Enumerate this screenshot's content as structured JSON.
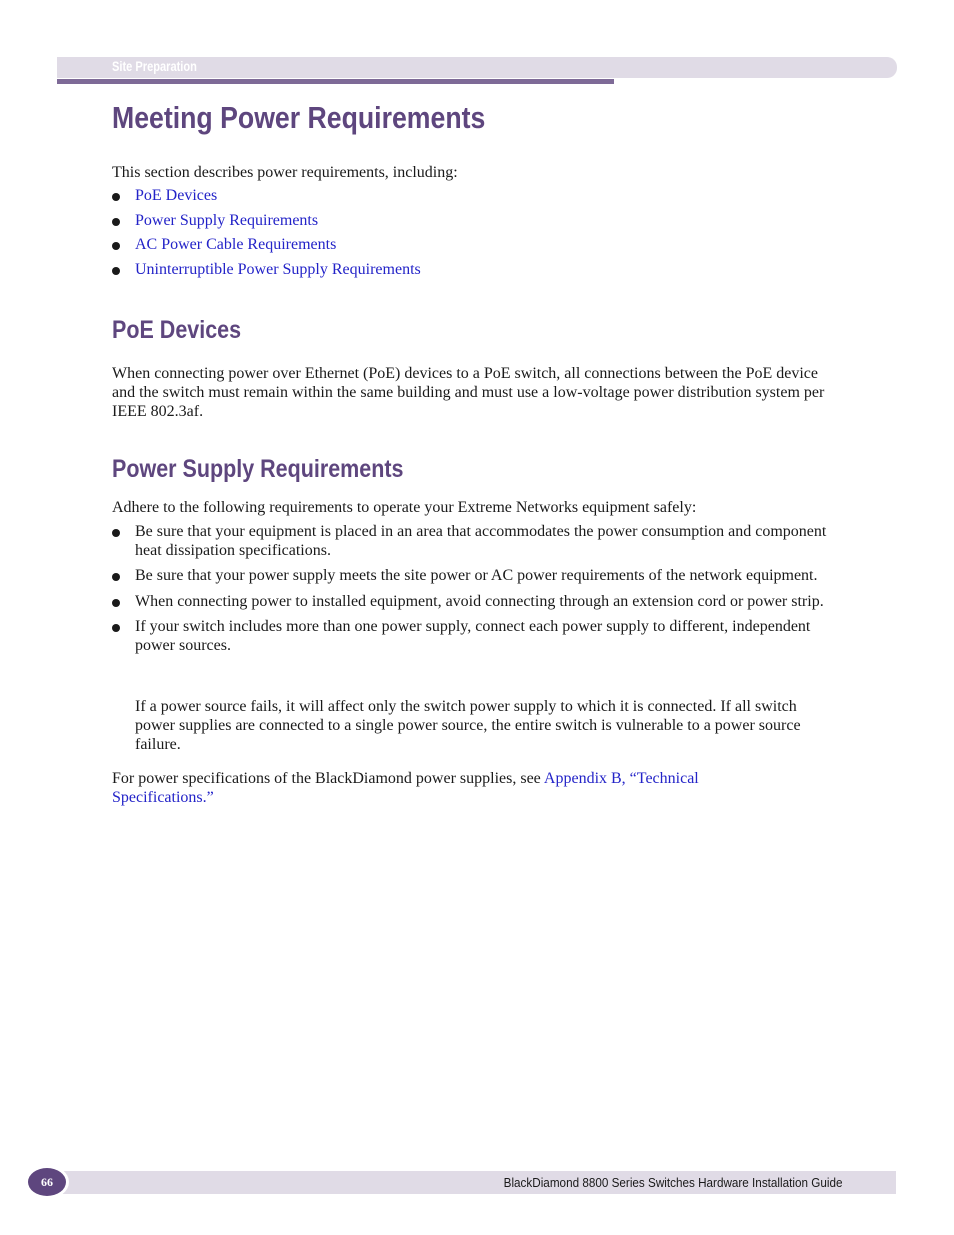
{
  "header": {
    "section_label": "Site Preparation"
  },
  "page_title": "Meeting Power Requirements",
  "intro": {
    "text": "This section describes power requirements, including:",
    "links": [
      {
        "label": "PoE Devices"
      },
      {
        "label": "Power Supply Requirements"
      },
      {
        "label": "AC Power Cable Requirements"
      },
      {
        "label": "Uninterruptible Power Supply Requirements"
      }
    ]
  },
  "poe_section": {
    "heading": "PoE Devices",
    "body": "When connecting power over Ethernet (PoE) devices to a PoE switch, all connections between the PoE device and the switch must remain within the same building and must use a low-voltage power distribution system per IEEE 802.3af."
  },
  "power_supply_section": {
    "heading": "Power Supply Requirements",
    "intro": "Adhere to the following requirements to operate your Extreme Networks equipment safely:",
    "bullets": [
      {
        "text": "Be sure that your equipment is placed in an area that accommodates the power consumption and component heat dissipation specifications."
      },
      {
        "text": "Be sure that your power supply meets the site power or AC power requirements of the network equipment."
      },
      {
        "text": "When connecting power to installed equipment, avoid connecting through an extension cord or power strip."
      },
      {
        "text": "If your switch includes more than one power supply, connect each power supply to different, independent power sources."
      }
    ],
    "followup": "If a power source fails, it will affect only the switch power supply to which it is connected. If all switch power supplies are connected to a single power source, the entire switch is vulnerable to a power source failure.",
    "closing_prefix": "For power specifications of the BlackDiamond power supplies, see ",
    "closing_link": "Appendix B, “Technical Specifications.”"
  },
  "footer": {
    "page_number": "66",
    "document_title": "BlackDiamond 8800 Series Switches Hardware Installation Guide"
  }
}
